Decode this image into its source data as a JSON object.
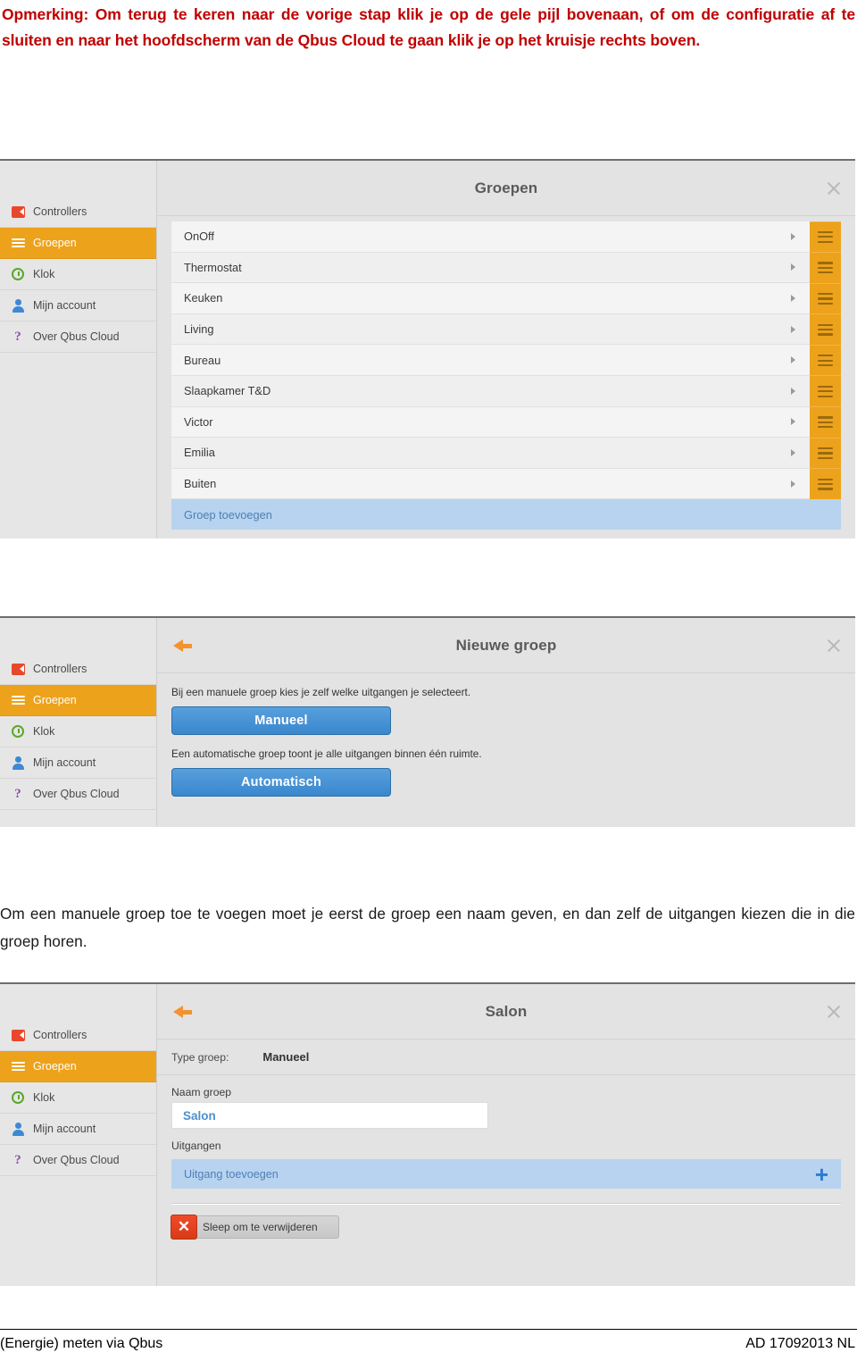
{
  "note": "Opmerking: Om terug te keren naar de vorige stap klik je op de gele pijl bovenaan, of om de configuratie af te sluiten en naar het hoofdscherm van de Qbus Cloud te gaan klik je op het kruisje rechts boven.",
  "paragraph": "Om een manuele groep toe te voegen moet je eerst de groep een naam geven, en dan zelf de uitgangen kiezen die in die groep horen.",
  "sidebar": {
    "items": [
      {
        "label": "Controllers",
        "icon": "controller-icon",
        "active": false
      },
      {
        "label": "Groepen",
        "icon": "hamburger-icon",
        "active": true
      },
      {
        "label": "Klok",
        "icon": "clock-icon",
        "active": false
      },
      {
        "label": "Mijn account",
        "icon": "user-icon",
        "active": false
      },
      {
        "label": "Over Qbus Cloud",
        "icon": "question-mark-icon",
        "active": false
      }
    ]
  },
  "screenshot1": {
    "title": "Groepen",
    "close_label": "×",
    "groups": [
      "OnOff",
      "Thermostat",
      "Keuken",
      "Living",
      "Bureau",
      "Slaapkamer T&D",
      "Victor",
      "Emilia",
      "Buiten"
    ],
    "add_group_label": "Groep toevoegen"
  },
  "screenshot2": {
    "title": "Nieuwe groep",
    "manual_description": "Bij een manuele groep kies je zelf welke uitgangen je selecteert.",
    "manual_button": "Manueel",
    "auto_description": "Een automatische groep toont je alle uitgangen binnen één ruimte.",
    "auto_button": "Automatisch"
  },
  "screenshot3": {
    "title": "Salon",
    "type_label": "Type groep:",
    "type_value": "Manueel",
    "name_label": "Naam groep",
    "name_value": "Salon",
    "outputs_label": "Uitgangen",
    "add_output_label": "Uitgang toevoegen",
    "add_output_plus": "+",
    "delete_label": "Sleep om te verwijderen",
    "delete_icon_glyph": "✕"
  },
  "footer": {
    "left": "(Energie) meten via Qbus",
    "right": "AD 17092013 NL"
  },
  "colors": {
    "note_red": "#C00000",
    "accent_orange": "#eda21c",
    "button_blue": "#3a87ce",
    "add_row_blue": "#b7d3f0",
    "delete_red": "#e8472b"
  }
}
